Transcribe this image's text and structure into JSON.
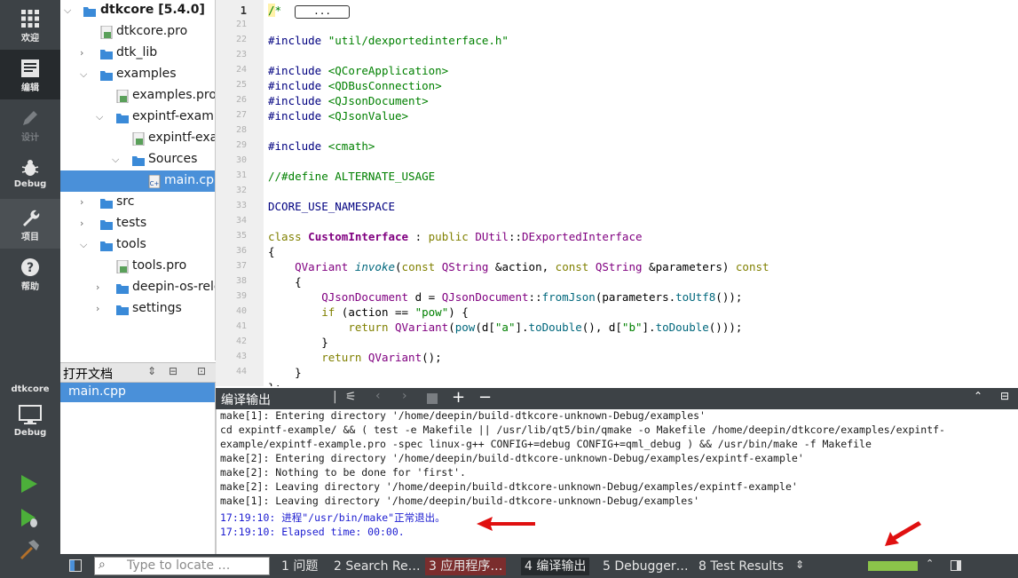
{
  "modes": [
    {
      "label": "欢迎",
      "icon": "grid-icon"
    },
    {
      "label": "编辑",
      "icon": "document-icon"
    },
    {
      "label": "设计",
      "icon": "pencil-icon"
    },
    {
      "label": "Debug",
      "icon": "bug-icon"
    },
    {
      "label": "项目",
      "icon": "wrench-icon"
    },
    {
      "label": "帮助",
      "icon": "help-icon"
    }
  ],
  "kit": {
    "project": "dtkcore",
    "config": "Debug"
  },
  "tree": [
    {
      "label": "dtkcore [5.4.0]"
    },
    {
      "label": "dtkcore.pro"
    },
    {
      "label": "dtk_lib"
    },
    {
      "label": "examples"
    },
    {
      "label": "examples.pro"
    },
    {
      "label": "expintf-example"
    },
    {
      "label": "expintf-example.pro"
    },
    {
      "label": "Sources"
    },
    {
      "label": "main.cpp"
    },
    {
      "label": "src"
    },
    {
      "label": "tests"
    },
    {
      "label": "tools"
    },
    {
      "label": "tools.pro"
    },
    {
      "label": "deepin-os-release"
    },
    {
      "label": "settings"
    }
  ],
  "open_docs": {
    "title": "打开文档",
    "items": [
      "main.cpp"
    ]
  },
  "editor": {
    "fold_placeholder": "...",
    "line_numbers": [
      "1",
      "21",
      "22",
      "23",
      "24",
      "25",
      "26",
      "27",
      "28",
      "29",
      "30",
      "31",
      "32",
      "33",
      "34",
      "35",
      "36",
      "37",
      "38",
      "39",
      "40",
      "41",
      "42",
      "43",
      "44"
    ]
  },
  "output": {
    "title": "编译输出",
    "lines": [
      "make[1]: Entering directory '/home/deepin/build-dtkcore-unknown-Debug/examples'",
      "cd expintf-example/ && ( test -e Makefile || /usr/lib/qt5/bin/qmake -o Makefile /home/deepin/dtkcore/examples/expintf-",
      "example/expintf-example.pro -spec linux-g++ CONFIG+=debug CONFIG+=qml_debug ) && /usr/bin/make -f Makefile",
      "make[2]: Entering directory '/home/deepin/build-dtkcore-unknown-Debug/examples/expintf-example'",
      "make[2]: Nothing to be done for 'first'.",
      "make[2]: Leaving directory '/home/deepin/build-dtkcore-unknown-Debug/examples/expintf-example'",
      "make[1]: Leaving directory '/home/deepin/build-dtkcore-unknown-Debug/examples'",
      "17:19:10: 进程\"/usr/bin/make\"正常退出。",
      "17:19:10: Elapsed time: 00:00."
    ]
  },
  "statusbar": {
    "locate_placeholder": "Type to locate …",
    "tabs": [
      "1 问题",
      "2 Search Re…",
      "3 应用程序…",
      "4 编译输出",
      "5 Debugger…",
      "8 Test Results"
    ],
    "progress": 1.0
  },
  "colors": {
    "accent": "#4a90d9",
    "progress": "#8bc34a",
    "annotation": "#e01010"
  }
}
